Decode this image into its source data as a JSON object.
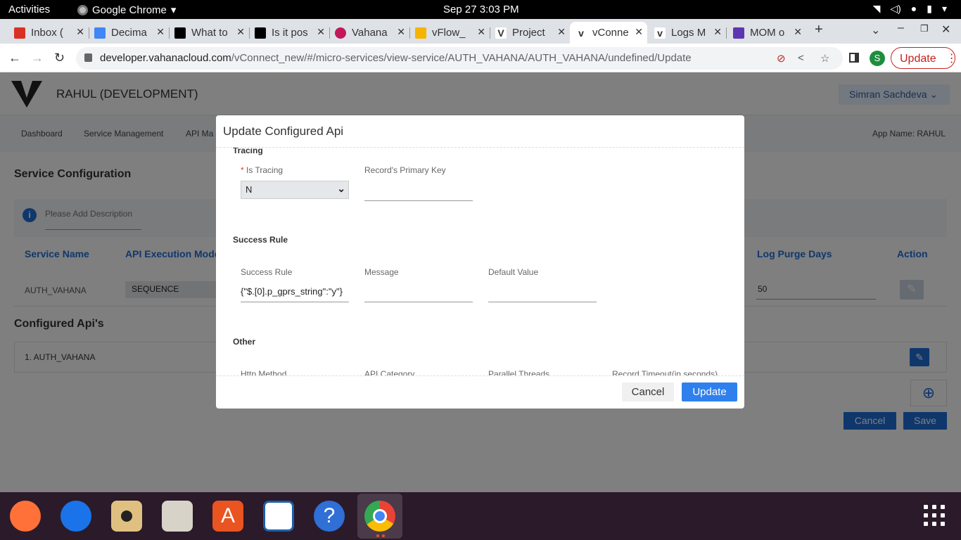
{
  "system": {
    "activities": "Activities",
    "app_name": "Google Chrome",
    "clock": "Sep 27  3:03 PM"
  },
  "tabs": [
    {
      "title": "Inbox (",
      "favicon_color": "#d93025"
    },
    {
      "title": "Decima",
      "favicon_color": "#4285f4"
    },
    {
      "title": "What to",
      "favicon_color": "#000000"
    },
    {
      "title": "Is it pos",
      "favicon_color": "#000000"
    },
    {
      "title": "Vahana",
      "favicon_color": "#c2185b"
    },
    {
      "title": "vFlow_",
      "favicon_color": "#f4b400"
    },
    {
      "title": "Project",
      "favicon_color": "#333333"
    },
    {
      "title": "vConne",
      "favicon_color": "#333333",
      "active": true
    },
    {
      "title": "Logs M",
      "favicon_color": "#333333"
    },
    {
      "title": "MOM o",
      "favicon_color": "#5e35b1"
    }
  ],
  "browser": {
    "url_domain": "developer.vahanacloud.com",
    "url_path": "/vConnect_new/#/micro-services/view-service/AUTH_VAHANA/AUTH_VAHANA/undefined/Update",
    "profile_initial": "S",
    "update_label": "Update"
  },
  "app": {
    "brand": "RAHUL (DEVELOPMENT)",
    "user": "Simran Sachdeva",
    "menu": [
      "Dashboard",
      "Service Management",
      "API Ma"
    ],
    "app_name_label": "App Name: RAHUL",
    "service_config_title": "Service Configuration",
    "description_placeholder": "Please Add Description",
    "columns": {
      "service_name": "Service Name",
      "api_execution_mode": "API Execution Mode",
      "log_purge_days": "Log Purge Days",
      "action": "Action"
    },
    "row": {
      "service_name": "AUTH_VAHANA",
      "execution_mode": "SEQUENCE",
      "log_purge_days": "50"
    },
    "configured_title": "Configured Api's",
    "configured_items": [
      "1. AUTH_VAHANA"
    ],
    "cancel_label": "Cancel",
    "save_label": "Save"
  },
  "modal": {
    "title": "Update Configured Api",
    "tracing_section": "Tracing",
    "is_tracing_label": "Is Tracing",
    "is_tracing_value": "N",
    "primary_key_label": "Record's Primary Key",
    "primary_key_value": "",
    "success_section": "Success Rule",
    "success_rule_label": "Success Rule",
    "success_rule_value": "{\"$.[0].p_gprs_string\":\"y\"}",
    "message_label": "Message",
    "message_value": "",
    "default_value_label": "Default Value",
    "default_value_value": "",
    "other_section": "Other",
    "http_method_label": "Http Method",
    "api_category_label": "API Category",
    "parallel_threads_label": "Parallel Threads",
    "record_timeout_label": "Record Timeout(in seconds)",
    "cancel_label": "Cancel",
    "update_label": "Update"
  },
  "dock": [
    {
      "name": "firefox-icon",
      "color": "#ff7139"
    },
    {
      "name": "thunderbird-icon",
      "color": "#1a73e8"
    },
    {
      "name": "rhythmbox-icon",
      "color": "#e0c080"
    },
    {
      "name": "files-icon",
      "color": "#d8d3c8"
    },
    {
      "name": "app-center-icon",
      "color": "#e95420"
    },
    {
      "name": "writer-icon",
      "color": "#1e5fa8"
    },
    {
      "name": "help-icon",
      "color": "#2f6fd6"
    },
    {
      "name": "chrome-icon",
      "color": "#4285f4"
    }
  ]
}
